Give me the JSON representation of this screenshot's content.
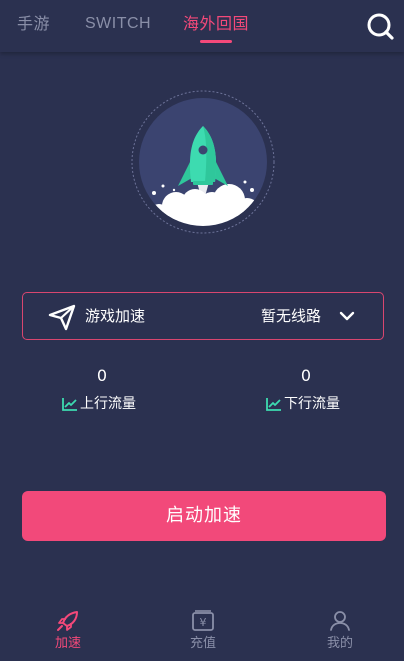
{
  "tabs": {
    "mobile": "手游",
    "switch": "SWITCH",
    "overseas": "海外回国",
    "active": "overseas"
  },
  "line_selector": {
    "game_label": "游戏加速",
    "route_label": "暂无线路"
  },
  "stats": {
    "upload_value": "0",
    "upload_label": "上行流量",
    "download_value": "0",
    "download_label": "下行流量"
  },
  "start_button": {
    "label": "启动加速"
  },
  "bottom_nav": {
    "accelerate": "加速",
    "recharge": "充值",
    "mine": "我的",
    "active": "accelerate"
  },
  "colors": {
    "background": "#2b3150",
    "accent": "#f4497a",
    "muted": "#8a8fa8",
    "rocket": "#3ddbb0",
    "trend_icon": "#3ddbb0"
  },
  "icons": {
    "search": "search-icon",
    "rocket": "rocket-icon",
    "plane": "paper-plane-icon",
    "chevron": "chevron-down-icon",
    "trend": "trend-up-icon",
    "nav_accelerate": "rocket-nav-icon",
    "nav_recharge": "wallet-yen-icon",
    "nav_mine": "user-icon"
  }
}
